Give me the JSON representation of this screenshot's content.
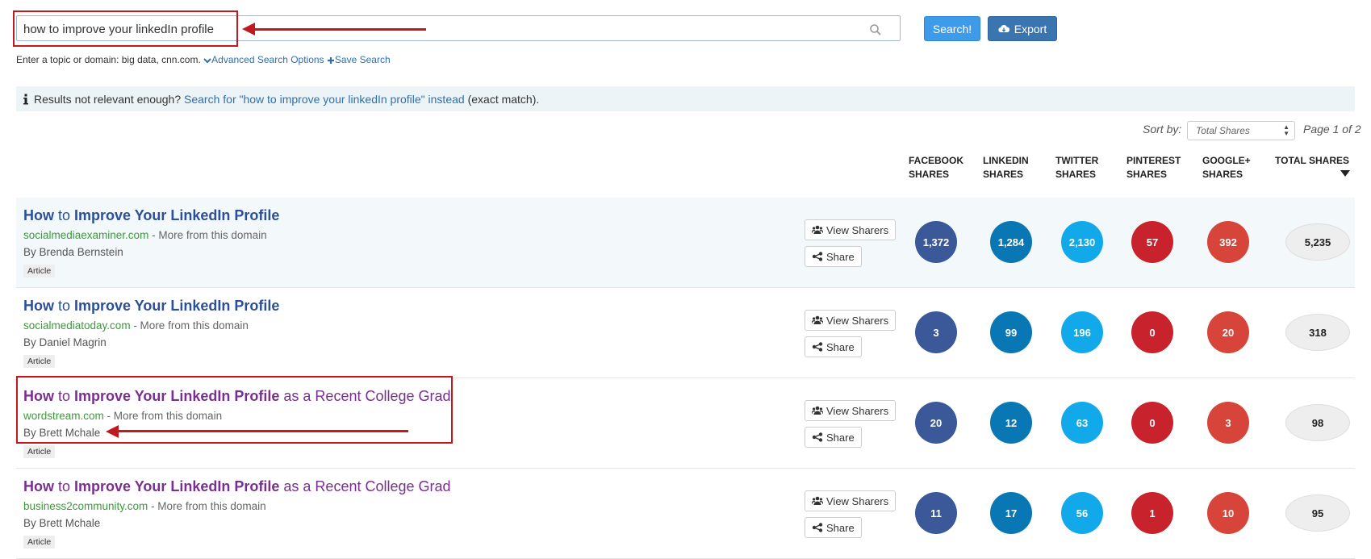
{
  "search": {
    "query": "how to improve your linkedIn profile",
    "search_button": "Search!",
    "export_button": "Export",
    "hint": "Enter a topic or domain: big data, cnn.com.",
    "advanced": "Advanced Search Options",
    "save": "Save Search"
  },
  "info": {
    "prefix": "Results not relevant enough?",
    "link": "Search for \"how to improve your linkedIn profile\" instead",
    "suffix": "(exact match)."
  },
  "sort": {
    "label": "Sort by:",
    "selected": "Total Shares",
    "page": "Page 1 of 2"
  },
  "columns": {
    "facebook": [
      "FACEBOOK",
      "SHARES"
    ],
    "linkedin": [
      "LINKEDIN",
      "SHARES"
    ],
    "twitter": [
      "TWITTER",
      "SHARES"
    ],
    "pinterest": [
      "PINTEREST",
      "SHARES"
    ],
    "googleplus": [
      "GOOGLE+",
      "SHARES"
    ],
    "total": [
      "TOTAL SHARES"
    ]
  },
  "buttons": {
    "view_sharers": "View Sharers",
    "share": "Share"
  },
  "colors": {
    "facebook": "#3b5998",
    "linkedin": "#0a77b5",
    "twitter": "#12a9eb",
    "pinterest": "#c8232c",
    "googleplus": "#d7443a",
    "annotation": "#c0191f"
  },
  "results": [
    {
      "title_parts": [
        "How",
        " to ",
        "Improve Your LinkedIn Profile",
        ""
      ],
      "domain": "socialmediaexaminer.com",
      "more": " - More from this domain",
      "author": "By Brenda Bernstein",
      "tag": "Article",
      "facebook": "1,372",
      "linkedin": "1,284",
      "twitter": "2,130",
      "pinterest": "57",
      "googleplus": "392",
      "total": "5,235"
    },
    {
      "title_parts": [
        "How",
        " to ",
        "Improve Your LinkedIn Profile",
        ""
      ],
      "domain": "socialmediatoday.com",
      "more": " - More from this domain",
      "author": "By Daniel Magrin",
      "tag": "Article",
      "facebook": "3",
      "linkedin": "99",
      "twitter": "196",
      "pinterest": "0",
      "googleplus": "20",
      "total": "318"
    },
    {
      "title_parts": [
        "How",
        " to ",
        "Improve Your LinkedIn Profile",
        " as a Recent College Grad"
      ],
      "domain": "wordstream.com",
      "more": " - More from this domain",
      "author": "By Brett Mchale",
      "tag": "Article",
      "facebook": "20",
      "linkedin": "12",
      "twitter": "63",
      "pinterest": "0",
      "googleplus": "3",
      "total": "98"
    },
    {
      "title_parts": [
        "How",
        " to ",
        "Improve Your LinkedIn Profile",
        " as a Recent College Grad"
      ],
      "domain": "business2community.com",
      "more": " - More from this domain",
      "author": "By Brett Mchale",
      "tag": "Article",
      "facebook": "11",
      "linkedin": "17",
      "twitter": "56",
      "pinterest": "1",
      "googleplus": "10",
      "total": "95"
    }
  ]
}
